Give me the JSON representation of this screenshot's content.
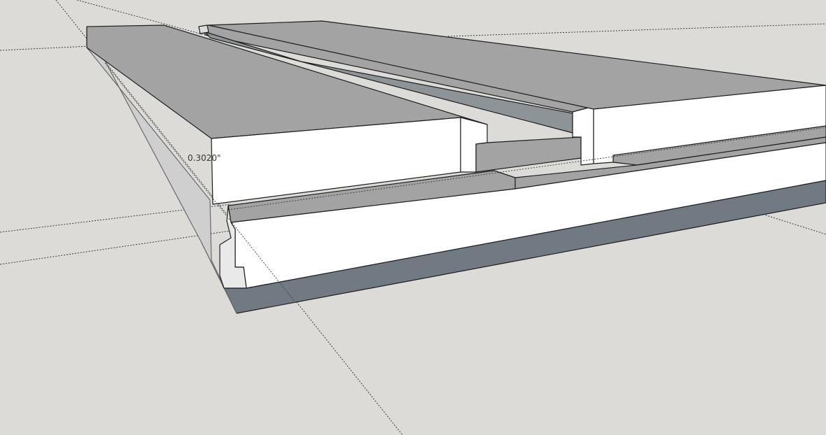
{
  "viewport": {
    "background_color": "#dcdbd7",
    "face_colors": {
      "top": "#a3a3a3",
      "side_light": "#ffffff",
      "side_dark": "#717a82",
      "edge": "#1e1e1e",
      "guide": "#3b3b3b"
    }
  },
  "measurement": {
    "value": "0.3020\""
  }
}
